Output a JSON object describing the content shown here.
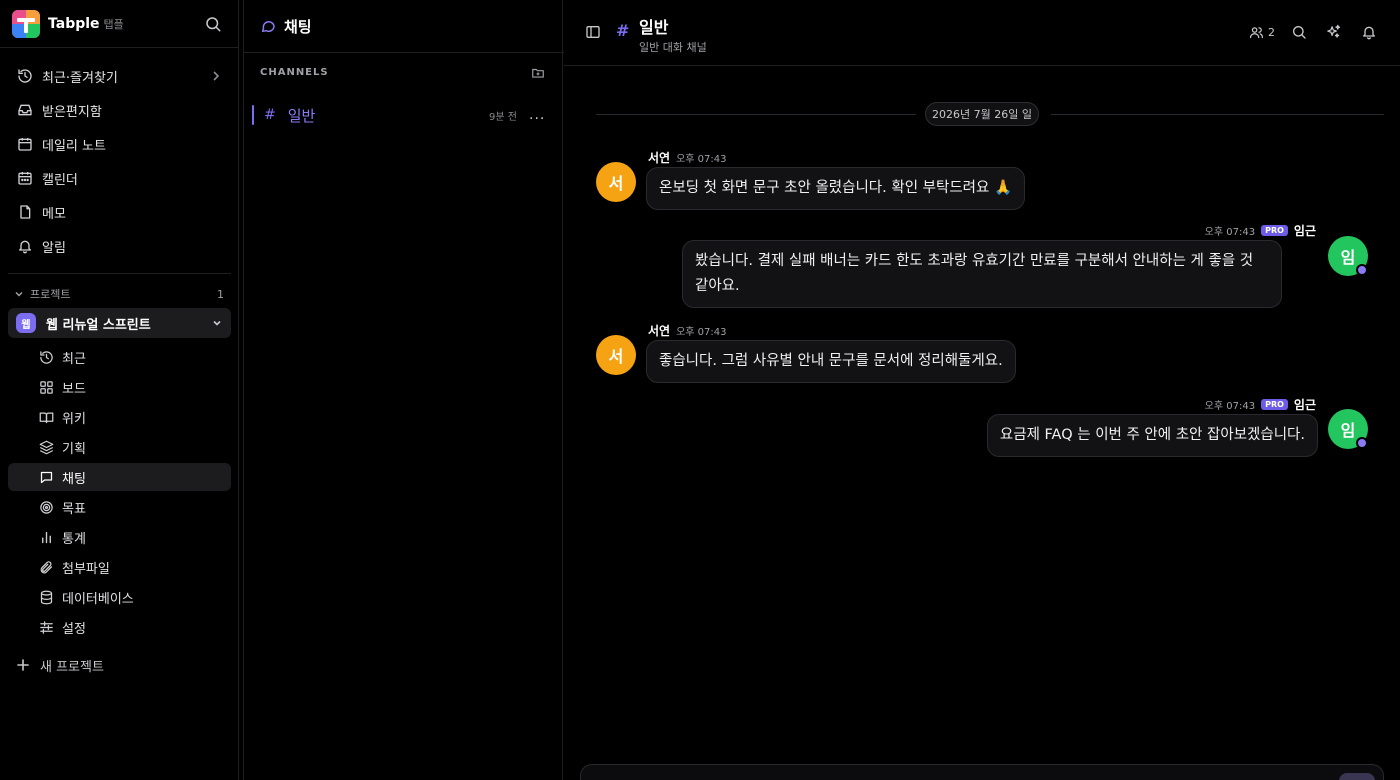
{
  "brand": {
    "name": "Tabple",
    "sub": "탭플"
  },
  "sidebar": {
    "nav": [
      {
        "label": "최근·즐겨찾기",
        "icon": "history-icon"
      },
      {
        "label": "받은편지함",
        "icon": "inbox-icon"
      },
      {
        "label": "데일리 노트",
        "icon": "calendar-icon"
      },
      {
        "label": "캘린더",
        "icon": "calendar-days-icon"
      },
      {
        "label": "메모",
        "icon": "memo-icon"
      },
      {
        "label": "알림",
        "icon": "bell-icon"
      }
    ],
    "section": {
      "label": "프로젝트",
      "count": "1"
    },
    "project": {
      "badge": "웹",
      "name": "웹 리뉴얼 스프린트"
    },
    "project_items": [
      {
        "label": "최근",
        "icon": "history-icon"
      },
      {
        "label": "보드",
        "icon": "board-icon"
      },
      {
        "label": "위키",
        "icon": "book-icon"
      },
      {
        "label": "기획",
        "icon": "layers-icon"
      },
      {
        "label": "채팅",
        "icon": "chat-icon",
        "active": true
      },
      {
        "label": "목표",
        "icon": "target-icon"
      },
      {
        "label": "통계",
        "icon": "bar-chart-icon"
      },
      {
        "label": "첨부파일",
        "icon": "paperclip-icon"
      },
      {
        "label": "데이터베이스",
        "icon": "database-icon"
      },
      {
        "label": "설정",
        "icon": "sliders-icon"
      }
    ],
    "new_project": "새 프로젝트"
  },
  "channels": {
    "title": "채팅",
    "section_label": "CHANNELS",
    "items": [
      {
        "name": "일반",
        "time": "9분 전",
        "more": "..."
      }
    ]
  },
  "chat": {
    "channel_name": "일반",
    "channel_desc": "일반 대화 채널",
    "members": "2",
    "date": "2026년 7월 26일 일",
    "messages": [
      {
        "author": "서연",
        "avatar": "서",
        "time": "오후 07:43",
        "text": "온보딩 첫 화면 문구 초안 올렸습니다. 확인 부탁드려요 🙏",
        "mine": false
      },
      {
        "author": "임근",
        "avatar": "임",
        "time": "오후 07:43",
        "badge": "PRO",
        "text_line1": "봤습니다. 결제 실패 배너는 카드 한도 초과랑 유효기간 만료를 구분해서 안내하는 게 좋을 것",
        "text_line2": "같아요.",
        "mine": true
      },
      {
        "author": "서연",
        "avatar": "서",
        "time": "오후 07:43",
        "text": "좋습니다. 그럼 사유별 안내 문구를 문서에 정리해둘게요.",
        "mine": false
      },
      {
        "author": "임근",
        "avatar": "임",
        "time": "오후 07:43",
        "badge": "PRO",
        "text": "요금제 FAQ 는 이번 주 안에 초안 잡아보겠습니다.",
        "mine": true
      }
    ]
  },
  "colors": {
    "accent": "#7c6cf0",
    "avatar_orange": "#f5a213",
    "avatar_green": "#22c55e",
    "pro_badge": "#6d5ce8"
  }
}
